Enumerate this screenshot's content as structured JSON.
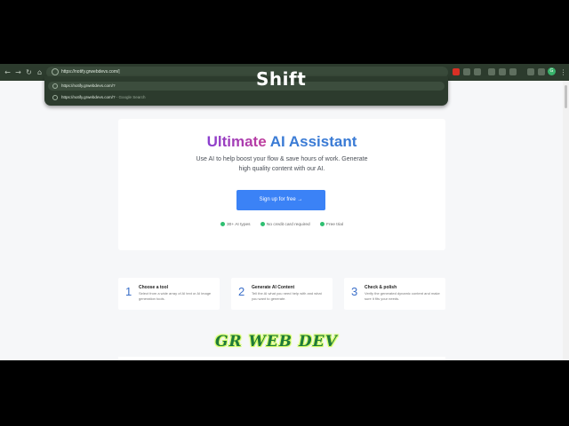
{
  "browser": {
    "address_text": "https://notify.grwebdevs.com/|",
    "suggestions": [
      {
        "text": "https://notify.grwebdevs.com/?",
        "muted": ""
      },
      {
        "text": "https://notify.grwebdevs.com/?",
        "muted": " - Google Search"
      }
    ],
    "nav_icons": [
      "back-arrow-icon",
      "forward-arrow-icon",
      "reload-icon",
      "home-icon"
    ],
    "profile_letter": "G"
  },
  "key_overlay": "Shift",
  "hero": {
    "title_part1": "Ultimate",
    "title_part2": " AI Assistant",
    "subtitle": "Use AI to help boost your flow & save hours of work. Generate high quality content with our AI.",
    "cta_label": "Sign up for free →",
    "features": [
      "30+ AI types",
      "No credit card required",
      "Free trial"
    ],
    "colors": {
      "accent": "#3b82f6",
      "gradient_start": "#8a3fd0",
      "gradient_end": "#c03c9a",
      "check": "#2fbf71"
    }
  },
  "steps": [
    {
      "num": "1",
      "title": "Choose a tool",
      "desc": "Select from a wide array of AI text or AI image generation tools."
    },
    {
      "num": "2",
      "title": "Generate AI Content",
      "desc": "Tell the AI what you need help with and what you want to generate."
    },
    {
      "num": "3",
      "title": "Check & polish",
      "desc": "Verify the generated dynamic content and make sure it fits your needs."
    }
  ],
  "watermark": "GR WEB DEV"
}
